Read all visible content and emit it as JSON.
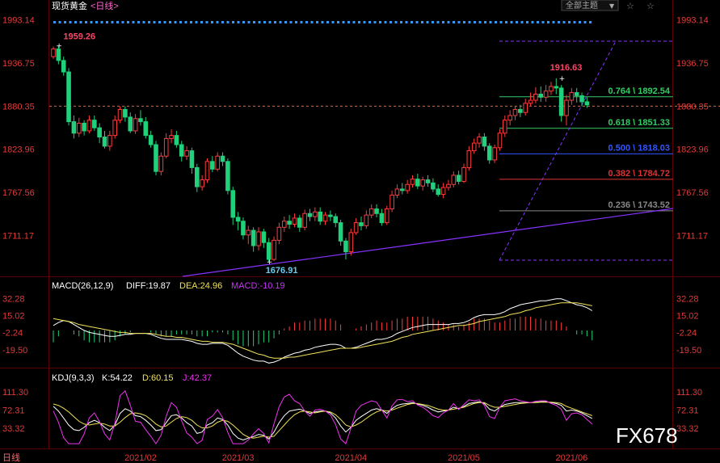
{
  "header": {
    "title": "现货黄金",
    "period_link": "<日线>",
    "dropdown_label": "全部主题",
    "dropdown_arrow": "▼",
    "right_icons": [
      "☆",
      "☆"
    ]
  },
  "colors": {
    "background": "#000000",
    "axis_text": "#e23a3a",
    "up": "#ff3b3b",
    "down": "#21d07a",
    "diff": "#ffffff",
    "dea": "#f0e25a",
    "macd": "#cc33ff",
    "k": "#ffffff",
    "d": "#f0e25a",
    "j": "#ee33ee",
    "trendline": "#8833ff",
    "fib_green": "#33cc66",
    "fib_blue": "#3355ff",
    "fib_red": "#dd3333",
    "fib_gray": "#888888",
    "dots": "#3399ff"
  },
  "chart_data": {
    "type": "candlestick",
    "title": "现货黄金<日线>",
    "main": {
      "y_ticks": [
        "1993.14",
        "1936.75",
        "1880.35",
        "1823.96",
        "1767.56",
        "1711.17"
      ],
      "ylim": [
        1660,
        2000
      ],
      "current_price_line": 1880.35,
      "annotations": [
        {
          "label": "1959.26",
          "type": "high"
        },
        {
          "label": "1676.91",
          "type": "low"
        },
        {
          "label": "1916.63",
          "type": "high"
        }
      ],
      "fibonacci": [
        {
          "label": "0.764 \\ 1892.54",
          "level": 1892.54,
          "color": "green"
        },
        {
          "label": "0.618 \\ 1851.33",
          "level": 1851.33,
          "color": "green"
        },
        {
          "label": "0.500 \\ 1818.03",
          "level": 1818.03,
          "color": "blue"
        },
        {
          "label": "0.382 \\ 1784.72",
          "level": 1784.72,
          "color": "red"
        },
        {
          "label": "0.236 \\ 1743.52",
          "level": 1743.52,
          "color": "gray"
        }
      ],
      "x_labels": [
        "2021/02",
        "2021/03",
        "2021/04",
        "2021/05",
        "2021/06"
      ],
      "candles": [
        [
          1945,
          1955,
          1958,
          1942
        ],
        [
          1955,
          1940,
          1959.26,
          1935
        ],
        [
          1940,
          1925,
          1945,
          1920
        ],
        [
          1925,
          1860,
          1930,
          1855
        ],
        [
          1860,
          1845,
          1868,
          1838
        ],
        [
          1845,
          1858,
          1865,
          1840
        ],
        [
          1858,
          1848,
          1862,
          1842
        ],
        [
          1848,
          1862,
          1868,
          1845
        ],
        [
          1862,
          1852,
          1868,
          1848
        ],
        [
          1852,
          1840,
          1858,
          1832
        ],
        [
          1840,
          1828,
          1848,
          1825
        ],
        [
          1828,
          1842,
          1848,
          1822
        ],
        [
          1842,
          1862,
          1868,
          1838
        ],
        [
          1862,
          1876,
          1880,
          1858
        ],
        [
          1876,
          1866,
          1880,
          1860
        ],
        [
          1866,
          1848,
          1872,
          1845
        ],
        [
          1848,
          1864,
          1870,
          1844
        ],
        [
          1864,
          1860,
          1875,
          1855
        ],
        [
          1860,
          1842,
          1866,
          1838
        ],
        [
          1842,
          1830,
          1848,
          1826
        ],
        [
          1830,
          1795,
          1835,
          1790
        ],
        [
          1795,
          1815,
          1820,
          1790
        ],
        [
          1815,
          1838,
          1845,
          1812
        ],
        [
          1838,
          1842,
          1850,
          1832
        ],
        [
          1842,
          1830,
          1848,
          1826
        ],
        [
          1830,
          1815,
          1835,
          1808
        ],
        [
          1815,
          1822,
          1828,
          1810
        ],
        [
          1822,
          1800,
          1826,
          1792
        ],
        [
          1800,
          1775,
          1805,
          1768
        ],
        [
          1775,
          1784,
          1790,
          1770
        ],
        [
          1784,
          1808,
          1812,
          1780
        ],
        [
          1808,
          1798,
          1815,
          1794
        ],
        [
          1798,
          1815,
          1820,
          1795
        ],
        [
          1815,
          1808,
          1820,
          1802
        ],
        [
          1808,
          1770,
          1812,
          1765
        ],
        [
          1770,
          1735,
          1775,
          1725
        ],
        [
          1735,
          1730,
          1742,
          1718
        ],
        [
          1730,
          1712,
          1735,
          1706
        ],
        [
          1712,
          1718,
          1724,
          1700
        ],
        [
          1718,
          1698,
          1722,
          1690
        ],
        [
          1698,
          1716,
          1722,
          1692
        ],
        [
          1716,
          1702,
          1720,
          1695
        ],
        [
          1702,
          1680,
          1708,
          1676.91
        ],
        [
          1680,
          1705,
          1710,
          1678
        ],
        [
          1705,
          1722,
          1728,
          1700
        ],
        [
          1722,
          1730,
          1736,
          1716
        ],
        [
          1730,
          1726,
          1738,
          1720
        ],
        [
          1726,
          1734,
          1740,
          1722
        ],
        [
          1734,
          1722,
          1738,
          1716
        ],
        [
          1722,
          1740,
          1745,
          1718
        ],
        [
          1740,
          1736,
          1746,
          1730
        ],
        [
          1736,
          1742,
          1748,
          1730
        ],
        [
          1742,
          1730,
          1748,
          1725
        ],
        [
          1730,
          1738,
          1742,
          1725
        ],
        [
          1738,
          1736,
          1744,
          1730
        ],
        [
          1736,
          1728,
          1740,
          1722
        ],
        [
          1728,
          1704,
          1732,
          1698
        ],
        [
          1704,
          1690,
          1708,
          1680
        ],
        [
          1690,
          1715,
          1720,
          1685
        ],
        [
          1715,
          1728,
          1734,
          1712
        ],
        [
          1728,
          1724,
          1736,
          1718
        ],
        [
          1724,
          1738,
          1744,
          1720
        ],
        [
          1738,
          1746,
          1752,
          1734
        ],
        [
          1746,
          1740,
          1752,
          1735
        ],
        [
          1740,
          1728,
          1746,
          1724
        ],
        [
          1728,
          1746,
          1750,
          1725
        ],
        [
          1746,
          1764,
          1770,
          1742
        ],
        [
          1764,
          1772,
          1778,
          1760
        ],
        [
          1772,
          1770,
          1780,
          1765
        ],
        [
          1770,
          1778,
          1784,
          1766
        ],
        [
          1778,
          1785,
          1790,
          1774
        ],
        [
          1785,
          1776,
          1792,
          1772
        ],
        [
          1776,
          1784,
          1788,
          1770
        ],
        [
          1784,
          1780,
          1790,
          1775
        ],
        [
          1780,
          1772,
          1786,
          1768
        ],
        [
          1772,
          1765,
          1778,
          1762
        ],
        [
          1765,
          1774,
          1780,
          1760
        ],
        [
          1774,
          1778,
          1784,
          1770
        ],
        [
          1778,
          1790,
          1795,
          1774
        ],
        [
          1790,
          1782,
          1796,
          1778
        ],
        [
          1782,
          1800,
          1805,
          1780
        ],
        [
          1800,
          1822,
          1828,
          1796
        ],
        [
          1822,
          1832,
          1838,
          1818
        ],
        [
          1832,
          1840,
          1845,
          1826
        ],
        [
          1840,
          1828,
          1845,
          1822
        ],
        [
          1828,
          1810,
          1832,
          1805
        ],
        [
          1810,
          1826,
          1830,
          1806
        ],
        [
          1826,
          1845,
          1850,
          1822
        ],
        [
          1845,
          1862,
          1868,
          1840
        ],
        [
          1862,
          1868,
          1875,
          1855
        ],
        [
          1868,
          1876,
          1880,
          1862
        ],
        [
          1876,
          1872,
          1882,
          1866
        ],
        [
          1872,
          1884,
          1890,
          1868
        ],
        [
          1884,
          1888,
          1898,
          1880
        ],
        [
          1888,
          1896,
          1905,
          1884
        ],
        [
          1896,
          1892,
          1906,
          1886
        ],
        [
          1892,
          1900,
          1908,
          1886
        ],
        [
          1900,
          1906,
          1912,
          1895
        ],
        [
          1906,
          1904,
          1916.63,
          1896
        ],
        [
          1904,
          1868,
          1908,
          1860
        ],
        [
          1868,
          1888,
          1895,
          1855
        ],
        [
          1888,
          1898,
          1904,
          1882
        ],
        [
          1898,
          1894,
          1904,
          1885
        ],
        [
          1894,
          1886,
          1898,
          1880
        ],
        [
          1886,
          1882,
          1892,
          1878
        ]
      ]
    },
    "macd": {
      "label": "MACD(26,12,9)",
      "diff_label": "DIFF:19.87",
      "dea_label": "DEA:24.96",
      "macd_label": "MACD:-10.19",
      "y_ticks": [
        "32.28",
        "15.02",
        "-2.24",
        "-19.50"
      ],
      "ylim": [
        -36,
        40
      ],
      "diff": [
        5,
        8,
        10,
        9,
        6,
        3,
        0,
        -2,
        -3,
        -4,
        -5,
        -6,
        -6,
        -5,
        -4,
        -4,
        -3,
        -3,
        -3,
        -4,
        -6,
        -8,
        -9,
        -9,
        -9,
        -9,
        -10,
        -11,
        -13,
        -14,
        -14,
        -13,
        -13,
        -13,
        -15,
        -19,
        -23,
        -26,
        -28,
        -30,
        -31,
        -31,
        -33,
        -32,
        -30,
        -27,
        -25,
        -23,
        -22,
        -20,
        -19,
        -17,
        -16,
        -15,
        -14,
        -14,
        -15,
        -18,
        -18,
        -17,
        -15,
        -13,
        -11,
        -9,
        -9,
        -8,
        -6,
        -3,
        -1,
        1,
        3,
        4,
        5,
        6,
        6,
        6,
        6,
        6,
        7,
        7,
        8,
        10,
        13,
        15,
        16,
        16,
        16,
        17,
        19,
        22,
        24,
        26,
        27,
        28,
        29,
        30,
        30,
        31,
        32,
        32,
        30,
        28,
        26,
        25,
        23,
        20
      ],
      "dea": [
        12,
        11,
        10,
        9,
        8,
        6,
        5,
        4,
        3,
        2,
        1,
        0,
        -1,
        -2,
        -2,
        -3,
        -3,
        -3,
        -3,
        -3,
        -4,
        -5,
        -6,
        -6,
        -7,
        -7,
        -8,
        -9,
        -10,
        -11,
        -11,
        -12,
        -12,
        -12,
        -13,
        -14,
        -16,
        -18,
        -20,
        -22,
        -24,
        -25,
        -27,
        -28,
        -28,
        -28,
        -27,
        -27,
        -26,
        -25,
        -24,
        -23,
        -22,
        -21,
        -20,
        -19,
        -18,
        -18,
        -18,
        -18,
        -17,
        -16,
        -15,
        -14,
        -13,
        -12,
        -11,
        -9,
        -7,
        -6,
        -4,
        -3,
        -2,
        -1,
        0,
        1,
        2,
        3,
        4,
        5,
        5,
        6,
        7,
        9,
        10,
        11,
        12,
        13,
        14,
        16,
        17,
        18,
        20,
        21,
        23,
        24,
        25,
        26,
        27,
        28,
        28,
        28,
        28,
        27,
        26,
        25
      ],
      "hist": [
        -12,
        -6,
        0,
        0,
        -4,
        -6,
        -10,
        -12,
        -12,
        -12,
        -12,
        -12,
        -10,
        -6,
        -4,
        -2,
        0,
        0,
        0,
        -2,
        -4,
        -6,
        -6,
        -6,
        -4,
        -4,
        -4,
        -4,
        -6,
        -6,
        -6,
        -2,
        -2,
        -2,
        -4,
        -10,
        -14,
        -16,
        -16,
        -16,
        -14,
        -12,
        -12,
        -8,
        -4,
        2,
        4,
        8,
        8,
        10,
        10,
        12,
        12,
        12,
        12,
        10,
        6,
        0,
        0,
        2,
        4,
        6,
        8,
        10,
        8,
        8,
        10,
        12,
        12,
        14,
        14,
        14,
        14,
        14,
        12,
        10,
        8,
        6,
        6,
        4,
        6,
        8,
        12,
        12,
        12,
        10,
        8,
        8,
        10,
        12,
        12,
        14,
        14,
        14,
        12,
        12,
        10,
        10,
        10,
        8,
        4,
        0,
        -4,
        -4,
        -6,
        -10
      ]
    },
    "kdj": {
      "label": "KDJ(9,3,3)",
      "k_label": "K:54.22",
      "d_label": "D:60.15",
      "j_label": "J:42.37",
      "y_ticks": [
        "111.30",
        "72.31",
        "33.32"
      ],
      "ylim": [
        -5,
        130
      ],
      "k": [
        80,
        70,
        55,
        40,
        30,
        28,
        35,
        45,
        50,
        45,
        35,
        28,
        40,
        65,
        75,
        70,
        60,
        58,
        50,
        40,
        28,
        30,
        45,
        60,
        62,
        55,
        45,
        38,
        22,
        25,
        40,
        45,
        55,
        52,
        40,
        22,
        12,
        8,
        12,
        15,
        20,
        18,
        10,
        25,
        45,
        60,
        70,
        72,
        74,
        70,
        65,
        68,
        70,
        70,
        66,
        55,
        38,
        25,
        35,
        50,
        58,
        65,
        72,
        75,
        72,
        65,
        75,
        82,
        85,
        86,
        88,
        85,
        82,
        78,
        72,
        68,
        70,
        72,
        78,
        75,
        80,
        86,
        88,
        90,
        86,
        74,
        70,
        78,
        84,
        86,
        88,
        88,
        88,
        88,
        89,
        90,
        90,
        88,
        86,
        82,
        70,
        72,
        70,
        66,
        60,
        54
      ],
      "d": [
        85,
        82,
        76,
        68,
        58,
        48,
        42,
        40,
        42,
        44,
        42,
        38,
        38,
        46,
        56,
        64,
        66,
        64,
        60,
        52,
        42,
        36,
        38,
        46,
        54,
        58,
        56,
        50,
        40,
        34,
        34,
        38,
        46,
        50,
        48,
        40,
        30,
        20,
        14,
        12,
        14,
        16,
        14,
        16,
        28,
        40,
        52,
        62,
        68,
        70,
        68,
        66,
        68,
        70,
        68,
        62,
        52,
        40,
        36,
        40,
        46,
        54,
        62,
        68,
        72,
        70,
        72,
        76,
        80,
        84,
        86,
        86,
        84,
        82,
        78,
        74,
        72,
        72,
        74,
        76,
        78,
        82,
        86,
        88,
        88,
        82,
        78,
        78,
        80,
        82,
        84,
        86,
        87,
        88,
        88,
        89,
        89,
        89,
        88,
        86,
        80,
        76,
        72,
        68,
        64,
        60
      ],
      "j": [
        70,
        46,
        13,
        0,
        0,
        0,
        21,
        55,
        66,
        47,
        21,
        8,
        44,
        103,
        113,
        82,
        48,
        46,
        30,
        16,
        0,
        18,
        59,
        88,
        78,
        49,
        23,
        14,
        0,
        7,
        52,
        59,
        73,
        56,
        24,
        0,
        0,
        0,
        8,
        21,
        32,
        22,
        2,
        43,
        79,
        100,
        106,
        92,
        86,
        70,
        59,
        72,
        74,
        70,
        62,
        41,
        10,
        0,
        33,
        70,
        82,
        87,
        92,
        89,
        72,
        55,
        81,
        94,
        95,
        90,
        92,
        83,
        78,
        70,
        60,
        56,
        66,
        72,
        86,
        73,
        84,
        94,
        92,
        94,
        82,
        58,
        54,
        78,
        92,
        94,
        96,
        92,
        90,
        88,
        91,
        92,
        92,
        86,
        82,
        74,
        50,
        64,
        66,
        62,
        52,
        42
      ]
    }
  },
  "footer": {
    "period_label": "日线",
    "watermark": "FX678"
  }
}
